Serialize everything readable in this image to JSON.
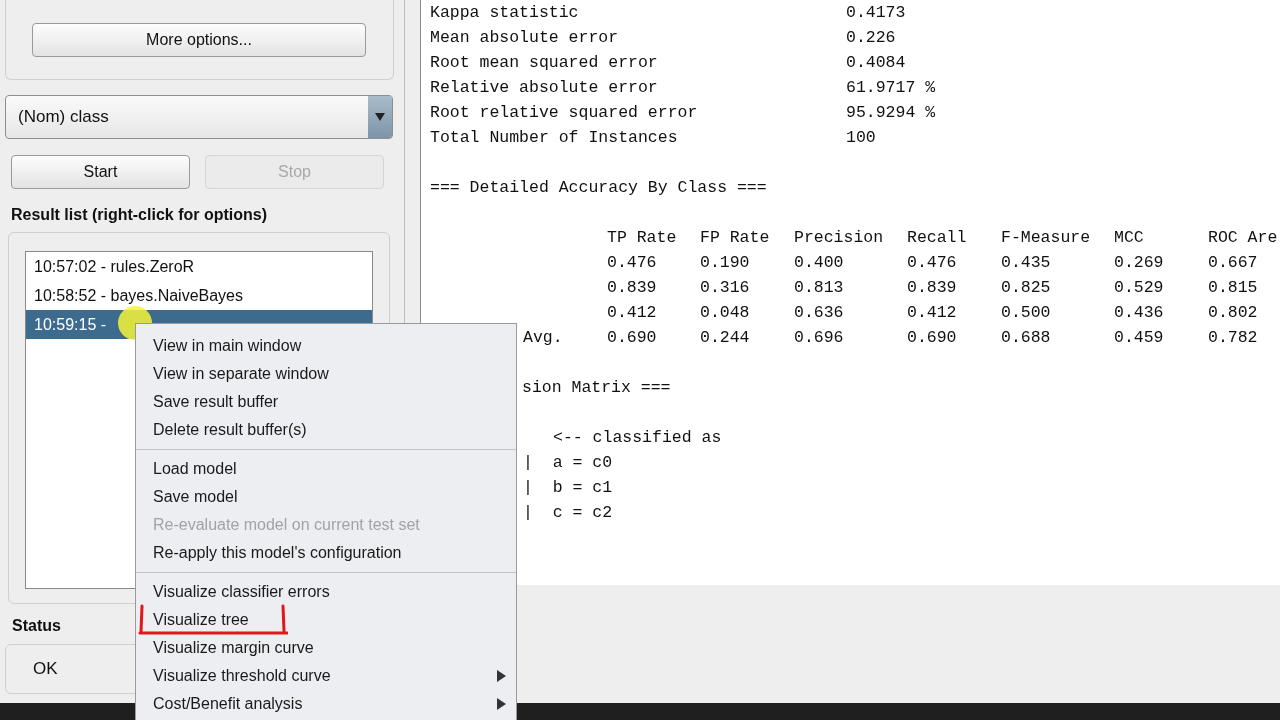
{
  "left_panel": {
    "more_options_button": "More options...",
    "class_dropdown": {
      "value": "(Nom) class"
    },
    "start_button": {
      "label": "Start",
      "disabled": false
    },
    "stop_button": {
      "label": "Stop",
      "disabled": true
    },
    "result_list": {
      "title": "Result list (right-click for options)",
      "items": [
        {
          "label": "10:57:02 - rules.ZeroR",
          "selected": false
        },
        {
          "label": "10:58:52 - bayes.NaiveBayes",
          "selected": false
        },
        {
          "label": "10:59:15 -",
          "selected": true
        }
      ]
    },
    "status": {
      "title": "Status",
      "message": "OK"
    }
  },
  "output": {
    "stats": [
      {
        "label": "Kappa statistic",
        "value": "0.4173"
      },
      {
        "label": "Mean absolute error",
        "value": "0.226"
      },
      {
        "label": "Root mean squared error",
        "value": "0.4084"
      },
      {
        "label": "Relative absolute error",
        "value": "61.9717 %"
      },
      {
        "label": "Root relative squared error",
        "value": "95.9294 %"
      },
      {
        "label": "Total Number of Instances",
        "value": "100"
      }
    ],
    "accuracy_title": "=== Detailed Accuracy By Class ===",
    "accuracy_table": {
      "columns": [
        "TP Rate",
        "FP Rate",
        "Precision",
        "Recall",
        "F-Measure",
        "MCC",
        "ROC Are"
      ],
      "rows": [
        {
          "label": "",
          "values": [
            "0.476",
            "0.190",
            "0.400",
            "0.476",
            "0.435",
            "0.269",
            "0.667"
          ]
        },
        {
          "label": "",
          "values": [
            "0.839",
            "0.316",
            "0.813",
            "0.839",
            "0.825",
            "0.529",
            "0.815"
          ]
        },
        {
          "label": "",
          "values": [
            "0.412",
            "0.048",
            "0.636",
            "0.412",
            "0.500",
            "0.436",
            "0.802"
          ]
        },
        {
          "label": "Avg.",
          "values": [
            "0.690",
            "0.244",
            "0.696",
            "0.690",
            "0.688",
            "0.459",
            "0.782"
          ]
        }
      ]
    },
    "matrix_title": "sion Matrix ===",
    "matrix_lines": [
      {
        "kind": "header",
        "text": "<-- classified as"
      },
      {
        "kind": "row",
        "text": "|  a = c0"
      },
      {
        "kind": "row",
        "text": "|  b = c1"
      },
      {
        "kind": "row",
        "text": "|  c = c2"
      }
    ]
  },
  "context_menu": {
    "groups": [
      [
        {
          "label": "View in main window",
          "disabled": false,
          "submenu": false
        },
        {
          "label": "View in separate window",
          "disabled": false,
          "submenu": false
        },
        {
          "label": "Save result buffer",
          "disabled": false,
          "submenu": false
        },
        {
          "label": "Delete result buffer(s)",
          "disabled": false,
          "submenu": false
        }
      ],
      [
        {
          "label": "Load model",
          "disabled": false,
          "submenu": false
        },
        {
          "label": "Save model",
          "disabled": false,
          "submenu": false
        },
        {
          "label": "Re-evaluate model on current test set",
          "disabled": true,
          "submenu": false
        },
        {
          "label": "Re-apply this model's configuration",
          "disabled": false,
          "submenu": false
        }
      ],
      [
        {
          "label": "Visualize classifier errors",
          "disabled": false,
          "submenu": false
        },
        {
          "label": "Visualize tree",
          "disabled": false,
          "submenu": false,
          "annotated": true
        },
        {
          "label": "Visualize margin curve",
          "disabled": false,
          "submenu": false
        },
        {
          "label": "Visualize threshold curve",
          "disabled": false,
          "submenu": true
        },
        {
          "label": "Cost/Benefit analysis",
          "disabled": false,
          "submenu": true
        }
      ]
    ]
  }
}
